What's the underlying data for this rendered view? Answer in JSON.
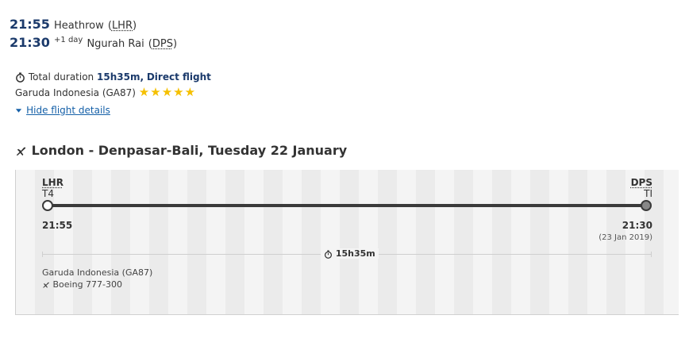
{
  "summary": {
    "depart": {
      "time": "21:55",
      "airport": "Heathrow",
      "code": "LHR"
    },
    "arrive": {
      "time": "21:30",
      "day_offset": "+1 day",
      "airport": "Ngurah Rai",
      "code": "DPS"
    }
  },
  "details": {
    "duration_label": "Total duration",
    "duration_value": "15h35m,",
    "flight_type": "Direct flight",
    "airline": "Garuda Indonesia (GA87)",
    "rating_stars": "★★★★★",
    "rating_value": 5,
    "hide_link": "Hide flight details"
  },
  "segment": {
    "heading": "London - Denpasar-Bali, Tuesday 22 January",
    "from": {
      "code": "LHR",
      "terminal": "T4",
      "time": "21:55"
    },
    "to": {
      "code": "DPS",
      "terminal": "TI",
      "time": "21:30",
      "date": "(23 Jan 2019)"
    },
    "duration": "15h35m",
    "airline": "Garuda Indonesia (GA87)",
    "aircraft": "Boeing 777-300"
  },
  "colors": {
    "accent": "#1b3a6b",
    "link": "#1560a8",
    "stars": "#f5c000",
    "track": "#3a3a3a"
  }
}
